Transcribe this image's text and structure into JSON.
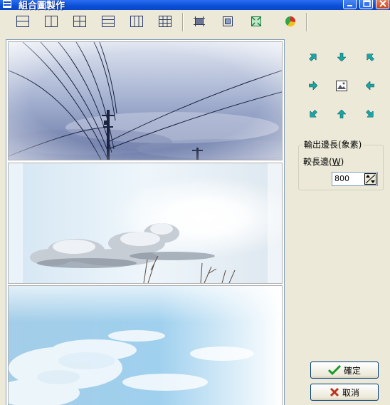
{
  "window": {
    "title": "組合圖製作"
  },
  "toolbar": {
    "layouts": [
      "layout-2-rows-icon",
      "layout-2-cols-icon",
      "layout-2x2-icon",
      "layout-3-rows-icon",
      "layout-3-cols-icon",
      "layout-3x3-icon"
    ],
    "tools": [
      "crop-icon",
      "fit-icon",
      "resize-icon",
      "color-icon"
    ]
  },
  "preview": {
    "tiles": [
      "sky-power-lines",
      "sky-sun-clouds",
      "sky-blue-clouds"
    ]
  },
  "output": {
    "group_title": "輸出邊長(象素)",
    "field_label_prefix": "較長邊(",
    "field_label_key": "W",
    "field_label_suffix": ")",
    "value": "800"
  },
  "buttons": {
    "ok": "確定",
    "cancel": "取消"
  },
  "colors": {
    "titlebar": "#0b4fd6",
    "face": "#ece9d8",
    "arrow": "#1aa6a6"
  }
}
